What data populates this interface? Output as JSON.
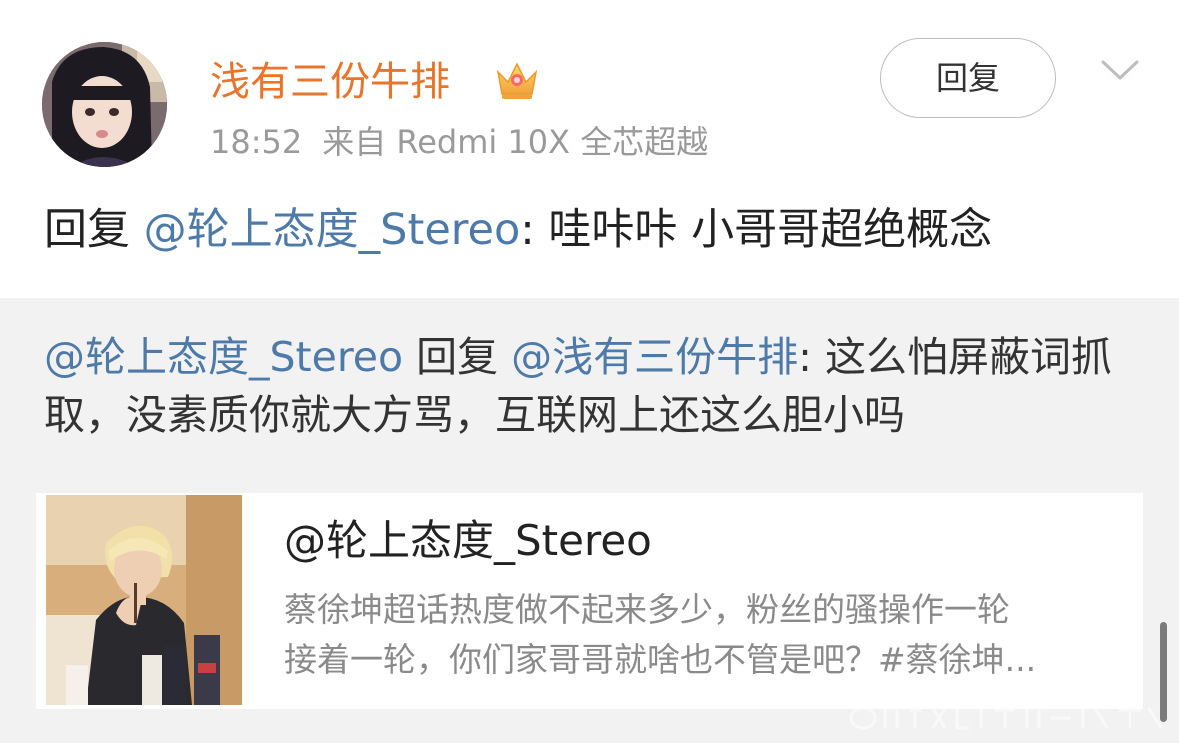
{
  "post": {
    "username": "浅有三份牛排",
    "time": "18:52",
    "source": "来自 Redmi 10X 全芯超越",
    "reply_button_label": "回复",
    "comment": {
      "prefix": "回复",
      "mention": "@轮上态度_Stereo",
      "text": ": 哇咔咔 小哥哥超绝概念"
    }
  },
  "quoted": {
    "mention1": "@轮上态度_Stereo",
    "middle": " 回复 ",
    "mention2": "@浅有三份牛排",
    "text": ": 这么怕屏蔽词抓取，没素质你就大方骂，互联网上还这么胆小吗"
  },
  "card": {
    "title": "@轮上态度_Stereo",
    "desc_line1": "蔡徐坤超话热度做不起来多少，粉丝的骚操作一轮",
    "desc_line2": "接着一轮，你们家哥哥就啥也不管是吧？#蔡徐坤..."
  },
  "icons": {
    "crown": "crown-badge-icon",
    "chevron": "chevron-down-icon"
  },
  "colors": {
    "username": "#e8752c",
    "mention": "#4d7aa8",
    "quote_bg": "#f2f2f2"
  }
}
